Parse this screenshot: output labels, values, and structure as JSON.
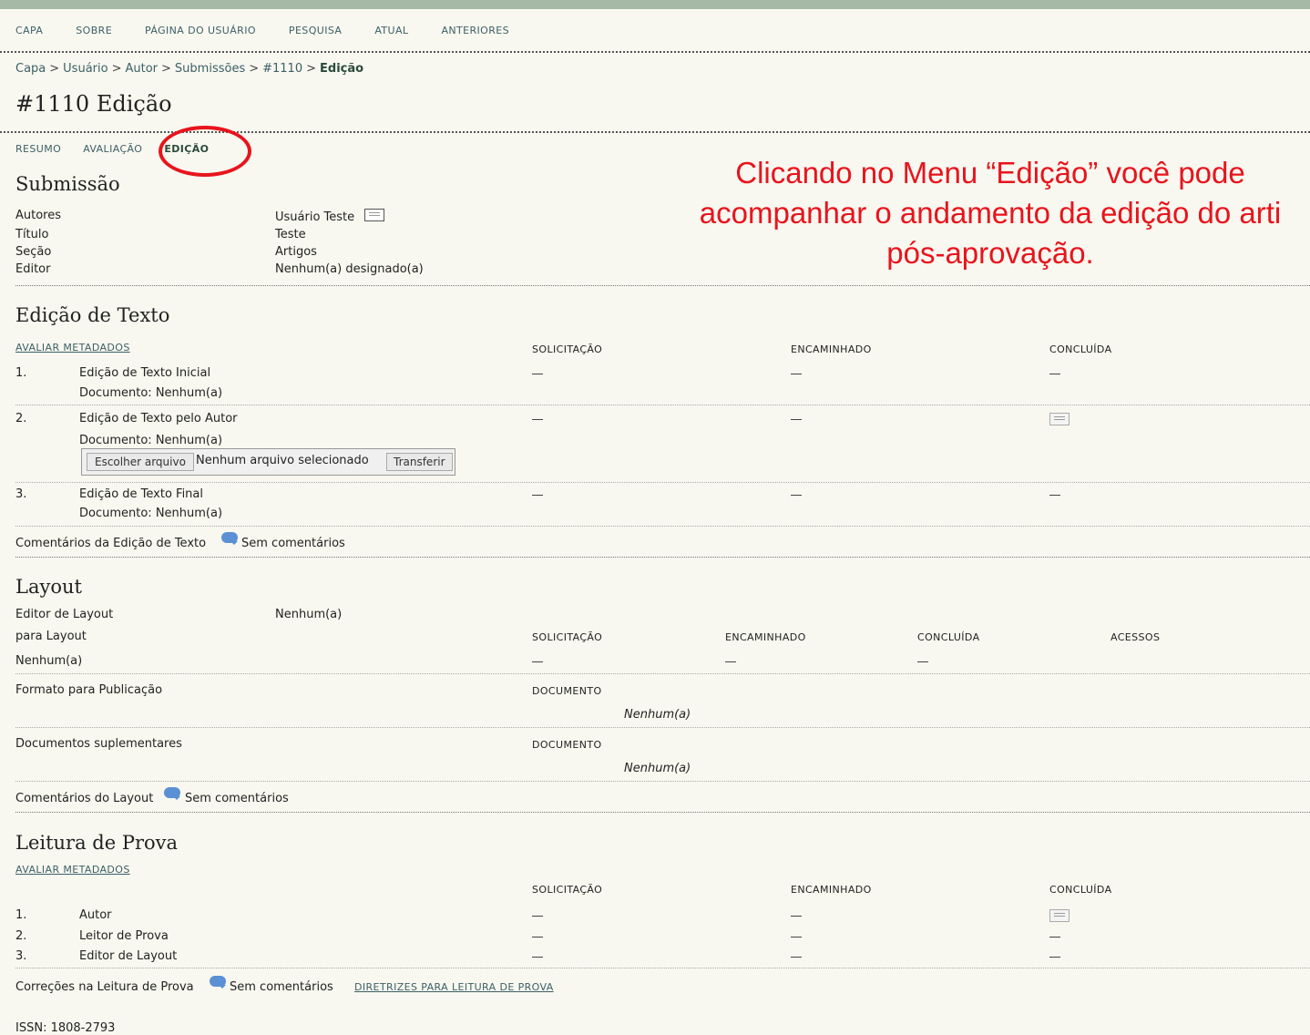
{
  "nav": [
    "CAPA",
    "SOBRE",
    "PÁGINA DO USUÁRIO",
    "PESQUISA",
    "ATUAL",
    "ANTERIORES"
  ],
  "breadcrumb": [
    "Capa",
    "Usuário",
    "Autor",
    "Submissões",
    "#1110",
    "Edição"
  ],
  "page_title": "#1110 Edição",
  "tabs": [
    "RESUMO",
    "AVALIAÇÃO",
    "EDIÇÃO"
  ],
  "annotation": [
    "Clicando no Menu “Edição” você pode",
    "acompanhar o andamento da edição do arti",
    "pós-aprovação."
  ],
  "submission": {
    "title": "Submissão",
    "labels": [
      "Autores",
      "Título",
      "Seção",
      "Editor"
    ],
    "values": [
      "Usuário Teste",
      "Teste",
      "Artigos",
      "Nenhum(a) designado(a)"
    ]
  },
  "copyedit": {
    "title": "Edição de Texto",
    "metadata_link": "AVALIAR METADADOS",
    "columns": [
      "SOLICITAÇÃO",
      "ENCAMINHADO",
      "CONCLUÍDA"
    ],
    "rows": [
      {
        "num": "1.",
        "name": "Edição de Texto Inicial",
        "doc": "Documento: Nenhum(a)"
      },
      {
        "num": "2.",
        "name": "Edição de Texto pelo Autor",
        "doc": "Documento: Nenhum(a)"
      },
      {
        "num": "3.",
        "name": "Edição de Texto Final",
        "doc": "Documento: Nenhum(a)"
      }
    ],
    "file_button": "Escolher arquivo",
    "file_status": "Nenhum arquivo selecionado",
    "upload_button": "Transferir",
    "comments_label": "Comentários da Edição de Texto",
    "comments_value": "Sem comentários"
  },
  "layout": {
    "title": "Layout",
    "editor_label": "Editor de Layout",
    "editor_value": "Nenhum(a)",
    "for_layout": "para Layout",
    "columns": [
      "SOLICITAÇÃO",
      "ENCAMINHADO",
      "CONCLUÍDA",
      "ACESSOS"
    ],
    "row_value": "Nenhum(a)",
    "format_label": "Formato para Publicação",
    "document_header": "DOCUMENTO",
    "format_value": "Nenhum(a)",
    "supp_label": "Documentos suplementares",
    "supp_header": "DOCUMENTO",
    "supp_value": "Nenhum(a)",
    "comments_label": "Comentários do Layout",
    "comments_value": "Sem comentários"
  },
  "proof": {
    "title": "Leitura de Prova",
    "metadata_link": "AVALIAR METADADOS",
    "columns": [
      "SOLICITAÇÃO",
      "ENCAMINHADO",
      "CONCLUÍDA"
    ],
    "rows": [
      {
        "num": "1.",
        "name": "Autor"
      },
      {
        "num": "2.",
        "name": "Leitor de Prova"
      },
      {
        "num": "3.",
        "name": "Editor de Layout"
      }
    ],
    "comments_label": "Correções na Leitura de Prova",
    "comments_value": "Sem comentários",
    "guidelines_link": "DIRETRIZES PARA LEITURA DE PROVA"
  },
  "footer": "ISSN: 1808-2793"
}
